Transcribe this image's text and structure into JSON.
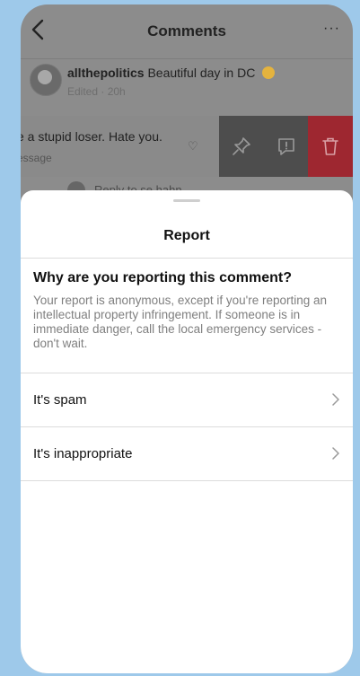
{
  "header": {
    "title": "Comments",
    "more": "···"
  },
  "post": {
    "username": "allthepolitics",
    "caption": "Beautiful day in DC",
    "meta": "Edited · 20h"
  },
  "comment": {
    "text": "e a stupid loser. Hate you.",
    "sub": "essage"
  },
  "reply": {
    "text": "Reply to se.hahn"
  },
  "sheet": {
    "title": "Report",
    "question": "Why are you reporting this comment?",
    "description": "Your report is anonymous, except if you're reporting an intellectual property infringement. If someone is in immediate danger, call the local emergency services - don't wait.",
    "options": [
      {
        "label": "It's spam"
      },
      {
        "label": "It's inappropriate"
      }
    ]
  },
  "colors": {
    "background": "#9ec9ea",
    "delete": "#9e2730",
    "overlay": "#8c8c8c"
  },
  "icons": [
    "back-arrow-icon",
    "more-icon",
    "heart-icon",
    "pin-icon",
    "report-icon",
    "trash-icon",
    "chevron-right-icon"
  ]
}
